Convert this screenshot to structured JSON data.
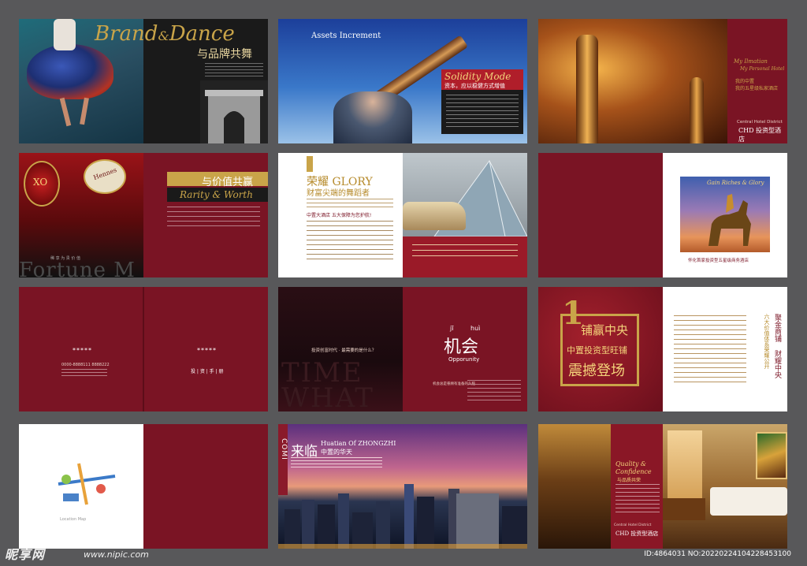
{
  "p1": {
    "title_a": "Brand",
    "title_amp": "&",
    "title_b": "Dance",
    "subtitle": "与品牌共舞"
  },
  "p2": {
    "caption": "Assets Increment",
    "badge_en": "Solidity Mode",
    "badge_cn": "资本，应以稳健方式增值"
  },
  "p3": {
    "tag_en1": "My Ilmatian",
    "tag_en2": "My Personal Hotel",
    "tag_cn1": "我的中置",
    "tag_cn2": "我的五星级私家酒店",
    "district": "Central Hotel District",
    "chd": "CHD 投资型酒店"
  },
  "p4": {
    "bottle": "Hennes",
    "label_xo": "XO",
    "heading_cn": "与价值共赢",
    "heading_en": "Rarity & Worth",
    "bottom_word": "Fortune M",
    "bottom_cn": "稀 享 为 贵 价 值"
  },
  "p5": {
    "heading": "荣耀 GLORY",
    "sub": "财富尖端的舞蹈者",
    "line1": "中置大酒店  五大保障为您护航!"
  },
  "p6": {
    "plate": "Gain Riches & Glory",
    "caption": "怀化首家投资型五星级商务酒店"
  },
  "p7": {
    "stars_left": "*****",
    "phone": "0000-8888111 8888222",
    "stars_right": "*****",
    "brochure": "投 | 资 | 手 | 册"
  },
  "p8": {
    "question": "投资创富时代 · 最需要的是什么？",
    "big1": "TIME",
    "big2": "WHAT",
    "pinyin1": "jī",
    "pinyin2": "huì",
    "hanzi": "机会",
    "en": "Opporunity",
    "note": "机会总是眷顾有准备的头脑"
  },
  "p9": {
    "numeral": "1",
    "l1": "铺赢中央",
    "l2": "中置投资型旺铺",
    "l3": "震撼登场",
    "v1": "聚金商铺",
    "v2": "财耀中央",
    "v3": "六大价值体系荣耀公开"
  },
  "p10": {
    "map_label": "Location Map"
  },
  "p11": {
    "side": "COMI",
    "title_cn": "来临",
    "title_en": "Huatian Of ZHONGZHI",
    "sub_cn": "中置的华天"
  },
  "p12": {
    "q1": "Quality &",
    "q2": "Confidence",
    "q3": "与品质共荣",
    "district": "Central Hotel District",
    "chd": "CHD 投资型酒店"
  },
  "watermark": {
    "brand": "昵享网",
    "url": "www.nipic.com",
    "id": "ID:4864031 NO:20220224104228453100"
  },
  "colors": {
    "crimson": "#7a1424",
    "gold": "#c9a449",
    "bg": "#58585a"
  }
}
